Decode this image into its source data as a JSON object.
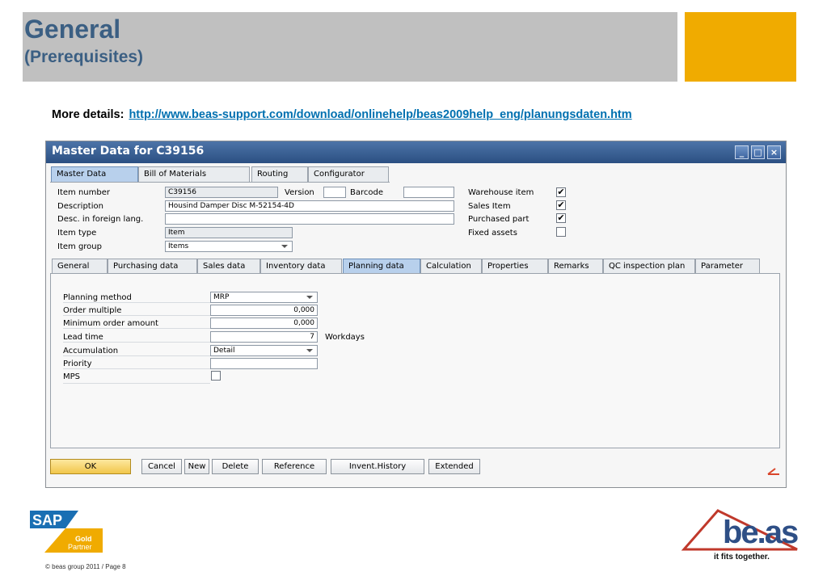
{
  "slide": {
    "title": "General",
    "subtitle": "(Prerequisites)",
    "details_label": "More details:",
    "details_link": "http://www.beas-support.com/download/onlinehelp/beas2009help_eng/planungsdaten.htm",
    "footer": "© beas group 2011 / Page 8",
    "sap_logo": "SAP",
    "sap_gold": "Gold",
    "sap_partner": "Partner",
    "beas_logo": "be.as",
    "beas_tagline": "it fits together."
  },
  "window": {
    "title": "Master Data for C39156",
    "minimize": "minimize-icon",
    "maximize": "maximize-icon",
    "close": "close-icon"
  },
  "top_tabs": [
    "Master Data",
    "Bill of Materials",
    "Routing",
    "Configurator"
  ],
  "header": {
    "item_number_label": "Item number",
    "item_number": "C39156",
    "version_label": "Version",
    "version": "",
    "barcode_label": "Barcode",
    "barcode": "",
    "description_label": "Description",
    "description": "Housind Damper Disc M-52154-4D",
    "foreign_label": "Desc. in foreign lang.",
    "foreign": "",
    "item_type_label": "Item type",
    "item_type": "Item",
    "item_group_label": "Item group",
    "item_group": "Items",
    "warehouse_label": "Warehouse item",
    "warehouse": true,
    "sales_label": "Sales Item",
    "sales": true,
    "purchased_label": "Purchased part",
    "purchased": true,
    "fixed_label": "Fixed assets",
    "fixed": false,
    "check_mark": "✔"
  },
  "sub_tabs": [
    "General",
    "Purchasing data",
    "Sales data",
    "Inventory data",
    "Planning data",
    "Calculation",
    "Properties",
    "Remarks",
    "QC inspection plan",
    "Parameter"
  ],
  "planning": {
    "method_label": "Planning method",
    "method": "MRP",
    "order_multiple_label": "Order multiple",
    "order_multiple": "0,000",
    "min_order_label": "Minimum order amount",
    "min_order": "0,000",
    "lead_time_label": "Lead time",
    "lead_time": "7",
    "lead_unit": "Workdays",
    "accumulation_label": "Accumulation",
    "accumulation": "Detail",
    "priority_label": "Priority",
    "priority": "",
    "mps_label": "MPS",
    "mps": false
  },
  "buttons": [
    "OK",
    "Cancel",
    "New",
    "Delete",
    "Reference",
    "Invent.History",
    "Extended"
  ],
  "colors": {
    "title_blue": "#3b5f83",
    "accent_orange": "#f0ab00",
    "header_gray": "#c0c0c0",
    "window_title": "#2b4f82"
  }
}
